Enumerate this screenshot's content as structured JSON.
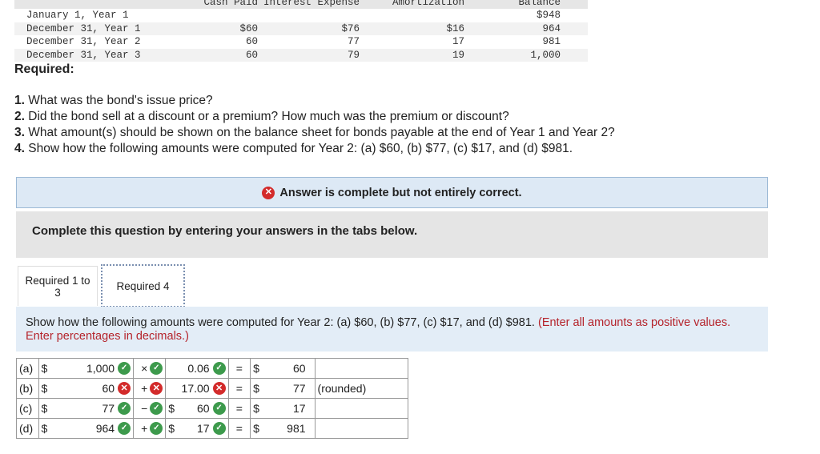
{
  "amortization": {
    "headers": {
      "cash": "Cash Paid",
      "interest": "Interest Expense",
      "amort": "Amortization",
      "balance": "Balance"
    },
    "rows": [
      {
        "date": "January 1, Year 1",
        "cash": "",
        "interest": "",
        "amort": "",
        "balance": "$948"
      },
      {
        "date": "December 31, Year 1",
        "cash": "$60",
        "interest": "$76",
        "amort": "$16",
        "balance": "964"
      },
      {
        "date": "December 31, Year 2",
        "cash": "60",
        "interest": "77",
        "amort": "17",
        "balance": "981"
      },
      {
        "date": "December 31, Year 3",
        "cash": "60",
        "interest": "79",
        "amort": "19",
        "balance": "1,000"
      }
    ]
  },
  "required_title": "Required:",
  "questions": [
    {
      "num": "1.",
      "text": " What was the bond's issue price?"
    },
    {
      "num": "2.",
      "text": " Did the bond sell at a discount or a premium? How much was the premium or discount?"
    },
    {
      "num": "3.",
      "text": " What amount(s) should be shown on the balance sheet for bonds payable at the end of Year 1 and Year 2?"
    },
    {
      "num": "4.",
      "text": " Show how the following amounts were computed for Year 2: (a) $60, (b) $77, (c) $17, and (d) $981."
    }
  ],
  "feedback": {
    "icon": "x-circle-icon",
    "text": "Answer is complete but not entirely correct."
  },
  "instruction": "Complete this question by entering your answers in the tabs below.",
  "tabs": [
    {
      "label": "Required 1 to 3"
    },
    {
      "label": "Required 4"
    }
  ],
  "prompt": {
    "main": "Show how the following amounts were computed for Year 2: (a) $60, (b) $77, (c) $17, and (d) $981. ",
    "note": "(Enter all amounts as positive values. Enter percentages in decimals.)"
  },
  "calc_rows": [
    {
      "label": "(a)",
      "cur1": "$",
      "val1": "1,000",
      "mark1": "correct",
      "op": "×",
      "mark_op": "correct",
      "cur2": "",
      "val2": "0.06",
      "mark2": "correct",
      "eq": "=",
      "cur3": "$",
      "result": "60",
      "note": ""
    },
    {
      "label": "(b)",
      "cur1": "$",
      "val1": "60",
      "mark1": "incorrect",
      "op": "+",
      "mark_op": "incorrect",
      "cur2": "",
      "val2": "17.00",
      "mark2": "incorrect",
      "eq": "=",
      "cur3": "$",
      "result": "77",
      "note": "(rounded)"
    },
    {
      "label": "(c)",
      "cur1": "$",
      "val1": "77",
      "mark1": "correct",
      "op": "−",
      "mark_op": "correct",
      "cur2": "$",
      "val2": "60",
      "mark2": "correct",
      "eq": "=",
      "cur3": "$",
      "result": "17",
      "note": ""
    },
    {
      "label": "(d)",
      "cur1": "$",
      "val1": "964",
      "mark1": "correct",
      "op": "+",
      "mark_op": "correct",
      "cur2": "$",
      "val2": "17",
      "mark2": "correct",
      "eq": "=",
      "cur3": "$",
      "result": "981",
      "note": ""
    }
  ],
  "colors": {
    "correct": "#3d9a4c",
    "incorrect": "#d32b2b",
    "accent_red": "#b5232b"
  }
}
